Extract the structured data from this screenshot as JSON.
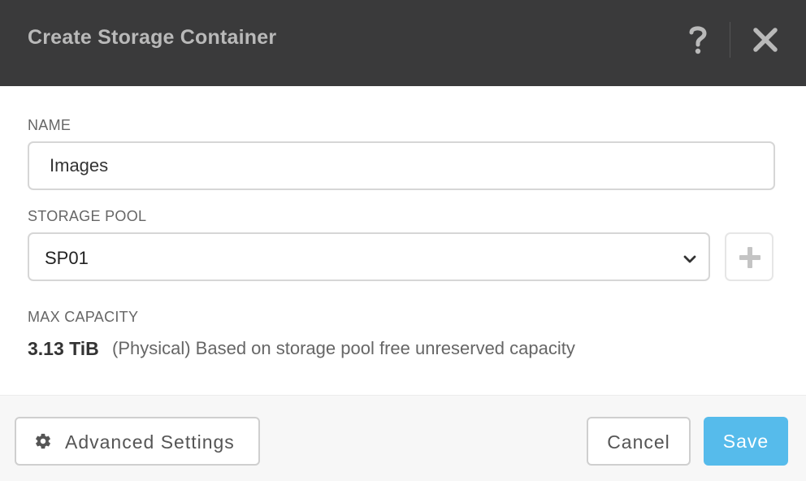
{
  "header": {
    "title": "Create Storage Container",
    "help_icon": "question-mark-icon",
    "close_icon": "close-icon"
  },
  "form": {
    "name_label": "NAME",
    "name_value": "Images",
    "storage_pool_label": "STORAGE POOL",
    "storage_pool_value": "SP01",
    "max_capacity_label": "MAX CAPACITY",
    "max_capacity_value": "3.13 TiB",
    "max_capacity_description": "(Physical) Based on storage pool free unreserved capacity"
  },
  "footer": {
    "advanced_label": "Advanced Settings",
    "cancel_label": "Cancel",
    "save_label": "Save"
  },
  "colors": {
    "header_bg": "#3a3a3b",
    "accent": "#56bbeb"
  }
}
